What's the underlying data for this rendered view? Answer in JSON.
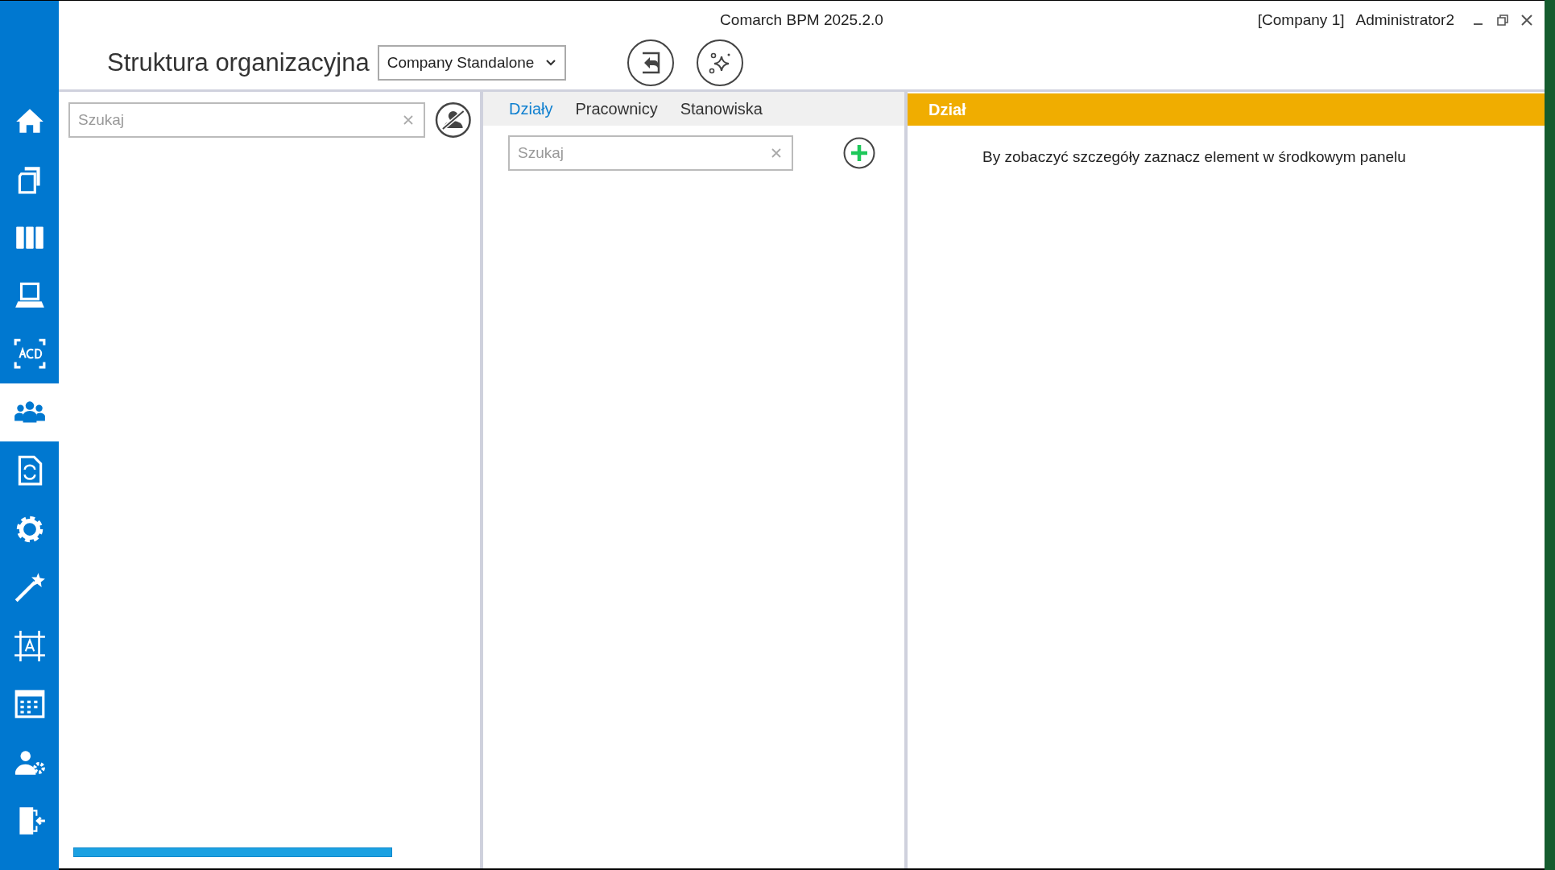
{
  "window": {
    "title": "Comarch BPM 2025.2.0",
    "company": "[Company 1]",
    "user": "Administrator2"
  },
  "sidebar": {
    "items": [
      {
        "kind": "home",
        "selected": false
      },
      {
        "kind": "documents",
        "selected": false
      },
      {
        "kind": "binders",
        "selected": false
      },
      {
        "kind": "scanner",
        "selected": false
      },
      {
        "kind": "ocr",
        "selected": false
      },
      {
        "kind": "people",
        "selected": true
      },
      {
        "kind": "workflow",
        "selected": false
      },
      {
        "kind": "settings",
        "selected": false
      },
      {
        "kind": "wand",
        "selected": false
      },
      {
        "kind": "template",
        "selected": false
      },
      {
        "kind": "calendar",
        "selected": false
      },
      {
        "kind": "user-settings",
        "selected": false
      },
      {
        "kind": "logout",
        "selected": false
      }
    ]
  },
  "header": {
    "title": "Struktura organizacyjna",
    "company_select": "Company Standalone"
  },
  "left_panel": {
    "search": {
      "placeholder": "Szukaj"
    }
  },
  "middle_panel": {
    "tabs": [
      {
        "label": "Działy",
        "selected": true
      },
      {
        "label": "Pracownicy",
        "selected": false
      },
      {
        "label": "Stanowiska",
        "selected": false
      }
    ],
    "search": {
      "placeholder": "Szukaj"
    }
  },
  "right_panel": {
    "header": "Dział",
    "message": "By zobaczyć szczegóły zaznacz element w środkowym panelu"
  }
}
